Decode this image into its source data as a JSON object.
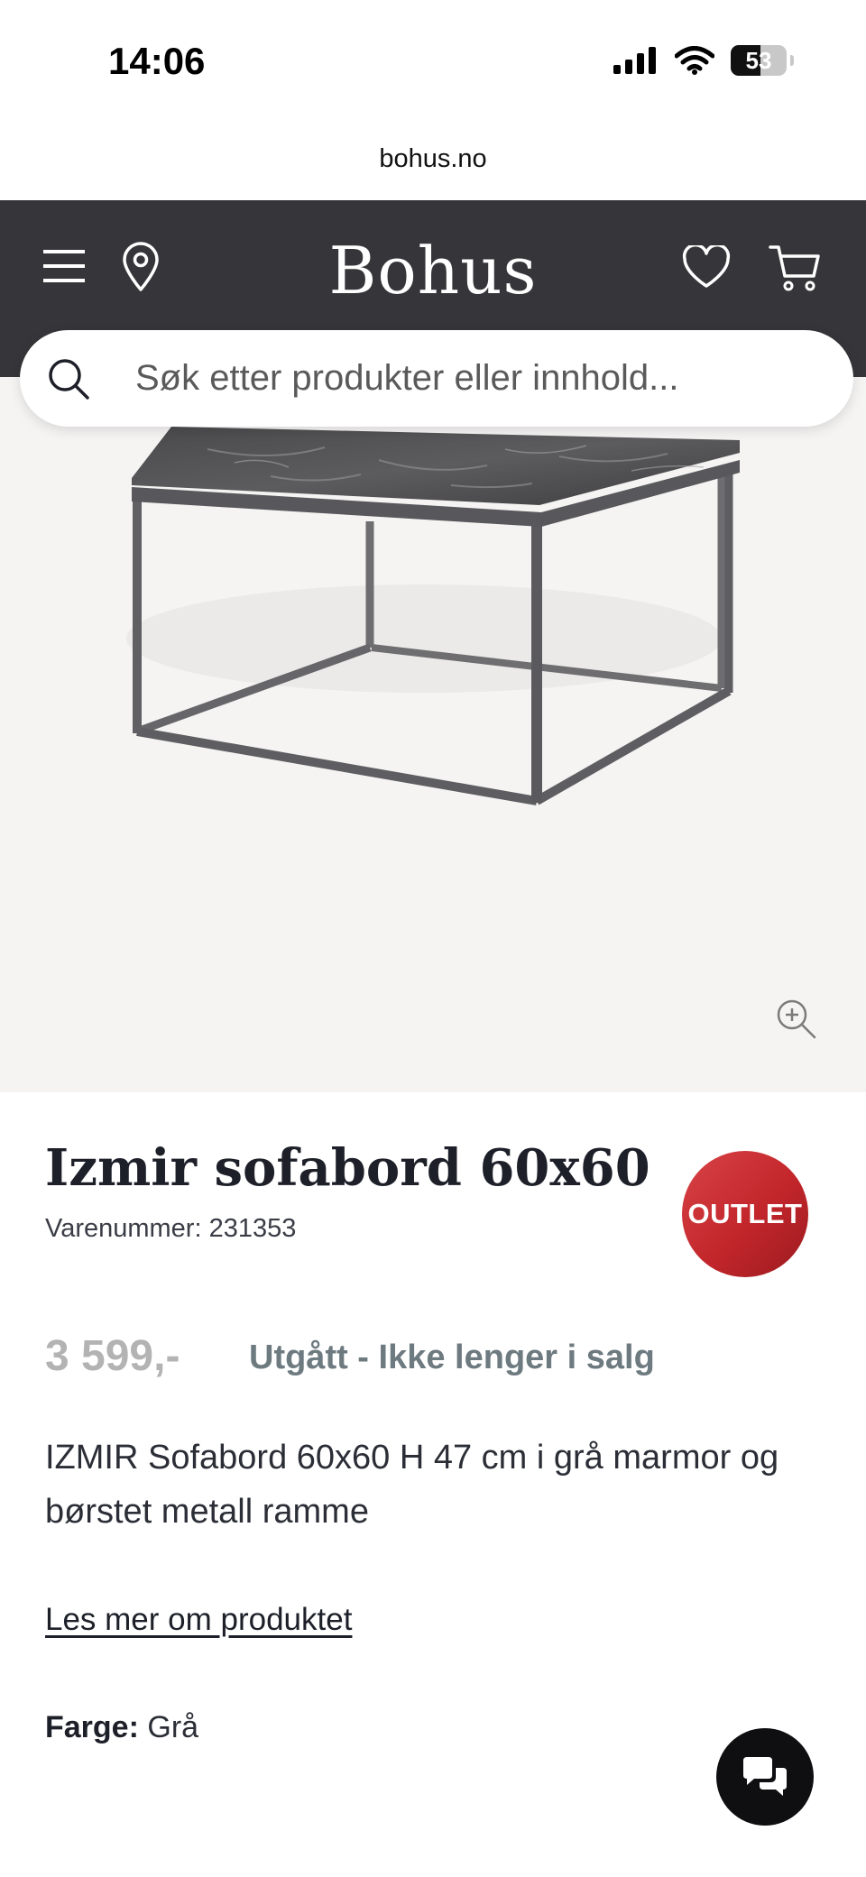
{
  "status_bar": {
    "time": "14:06",
    "battery": "53"
  },
  "browser": {
    "url": "bohus.no"
  },
  "header": {
    "logo": "Bohus"
  },
  "search": {
    "placeholder": "Søk etter produkter eller innhold..."
  },
  "product": {
    "title": "Izmir sofabord 60x60",
    "sku_label": "Varenummer:",
    "sku": "231353",
    "badge": "OUTLET",
    "price": "3 599,-",
    "availability": "Utgått - Ikke lenger i salg",
    "description": "IZMIR Sofabord 60x60 H 47 cm i grå marmor og børstet metall ramme",
    "read_more": "Les mer om produktet",
    "color_label": "Farge:",
    "color_value": "Grå"
  },
  "icons": {
    "menu": "menu-icon",
    "location": "location-pin-icon",
    "wishlist": "heart-icon",
    "cart": "cart-icon",
    "search": "search-icon",
    "zoom": "zoom-in-icon",
    "chat": "chat-icon"
  },
  "colors": {
    "header_bg": "#35353a",
    "badge": "#c2262b",
    "availability": "#6d7a80"
  }
}
